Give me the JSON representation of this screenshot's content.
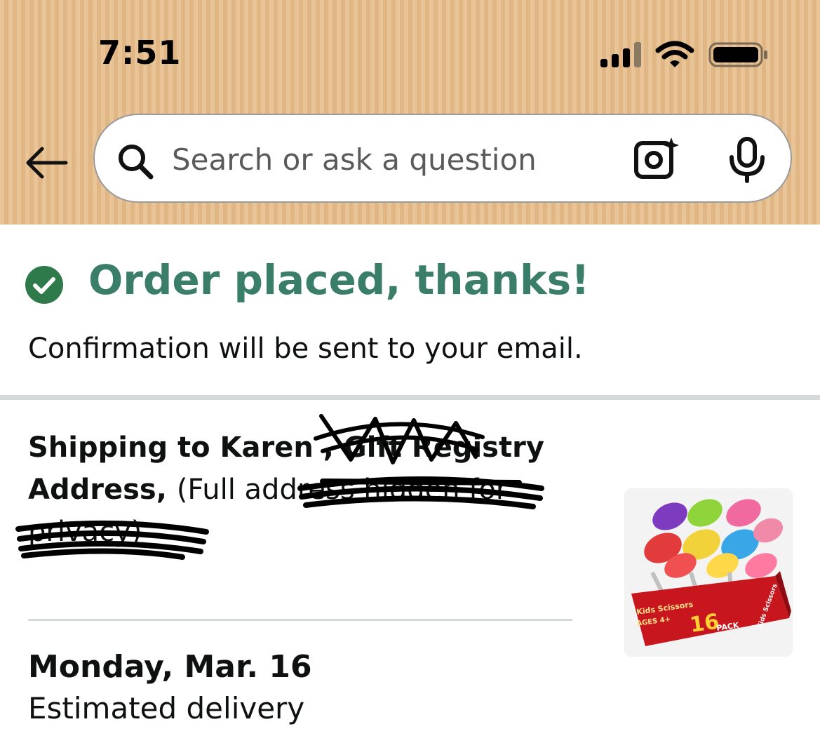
{
  "status_bar": {
    "time": "7:51",
    "signal_icon": "cellular-signal-icon",
    "wifi_icon": "wifi-icon",
    "battery_icon": "battery-icon"
  },
  "header": {
    "back_icon": "back-arrow-icon",
    "search": {
      "placeholder": "Search or ask a question",
      "search_icon": "search-icon",
      "camera_icon": "camera-lens-icon",
      "mic_icon": "microphone-icon"
    }
  },
  "order": {
    "title": "Order placed, thanks!",
    "subtitle": "Confirmation will be sent to your email.",
    "title_color": "#3a7d68"
  },
  "shipping": {
    "lead": "Shipping to Karen ",
    "name_tail": ", Gift Registry Address, ",
    "note": "(Full address hidden for privacy)"
  },
  "product": {
    "image_icon": "kids-scissors-product-image",
    "brand": "Kids Scissors",
    "ages": "AGES 4+",
    "pack_count": "16",
    "pack_label": "PACK",
    "side_label": "Kids Scissors"
  },
  "delivery": {
    "date": "Monday, Mar. 16",
    "label": "Estimated delivery"
  }
}
